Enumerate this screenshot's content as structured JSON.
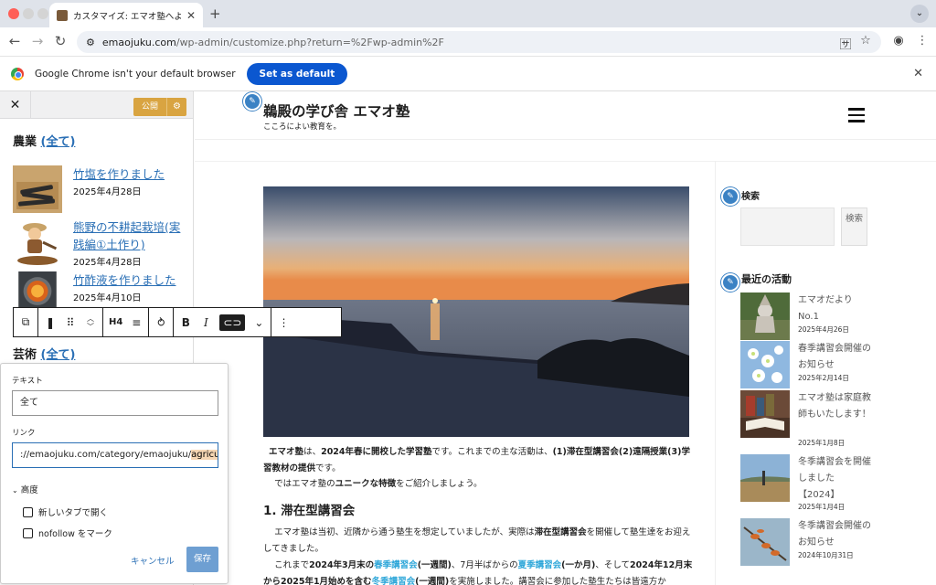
{
  "browser": {
    "tab_title": "カスタマイズ: エマオ塾へようこそ",
    "url_host": "emaojuku.com",
    "url_path": "/wp-admin/customize.php?return=%2Fwp-admin%2F"
  },
  "infobar": {
    "message": "Google Chrome isn't your default browser",
    "button": "Set as default"
  },
  "customizer": {
    "publish_label": "公開",
    "category1": {
      "name": "農業",
      "link": "(全て)"
    },
    "posts": [
      {
        "title": "竹塩を作りました",
        "date": "2025年4月28日"
      },
      {
        "title": "熊野の不耕起栽培(実践編①土作り)",
        "date": "2025年4月28日"
      },
      {
        "title": "竹酢液を作りました",
        "date": "2025年4月10日"
      }
    ],
    "category2": {
      "name": "芸術",
      "link": "(全て)"
    },
    "block_toolbar": {
      "heading_level": "H4"
    }
  },
  "link_popover": {
    "text_label": "テキスト",
    "text_value": "全て",
    "link_label": "リンク",
    "link_value_pre": "://emaojuku.com/category/emaojuku/",
    "link_value_sel": "agriculture/",
    "advanced": "高度",
    "new_tab": "新しいタブで開く",
    "nofollow": "nofollow をマーク",
    "cancel": "キャンセル",
    "save": "保存"
  },
  "site": {
    "title": "鵜殿の学び舎 エマオ塾",
    "tagline": "こころによい教育を。",
    "para1_a": "エマオ塾",
    "para1_b": "は、",
    "para1_c": "2024年春に開校した学習塾",
    "para1_d": "です。これまでの主な活動は、",
    "para1_e": "(1)滞在型講習会(2)遠隔授業(3)学習教材の提供",
    "para1_f": "です。",
    "para2_a": "ではエマオ塾の",
    "para2_b": "ユニークな特徴",
    "para2_c": "をご紹介しましょう。",
    "heading": "1. 滞在型講習会",
    "para3_a": "エマオ塾は当初、近隣から通う塾生を想定していましたが、実際は",
    "para3_b": "滞在型講習会",
    "para3_c": "を開催して塾生達をお迎えしてきました。",
    "para4_a": "これまで",
    "para4_b": "2024年3月末の",
    "para4_c": "春季講習会",
    "para4_d": "(一週間)",
    "para4_e": "、7月半ばからの",
    "para4_f": "夏季講習会",
    "para4_g": "(一か月)",
    "para4_h": "、そして",
    "para4_i": "2024年12月末から2025年1月始めを含む",
    "para4_j": "冬季講習会",
    "para4_k": "(一週間)",
    "para4_l": "を実施しました。講習会に参加した塾生たちは皆遠方か"
  },
  "sidebar": {
    "search_title": "検索",
    "search_button": "検索",
    "recent_title": "最近の活動",
    "items": [
      {
        "title": "エマオだより No.1",
        "date": "2025年4月26日"
      },
      {
        "title": "春季講習会開催のお知らせ",
        "date": "2025年2月14日"
      },
      {
        "title": "エマオ塾は家庭教師もいたします！",
        "date": "2025年1月8日"
      },
      {
        "title": "冬季講習会を開催しました【2024】",
        "date": "2025年1月4日"
      },
      {
        "title": "冬季講習会開催のお知らせ",
        "date": "2024年10月31日"
      }
    ]
  }
}
